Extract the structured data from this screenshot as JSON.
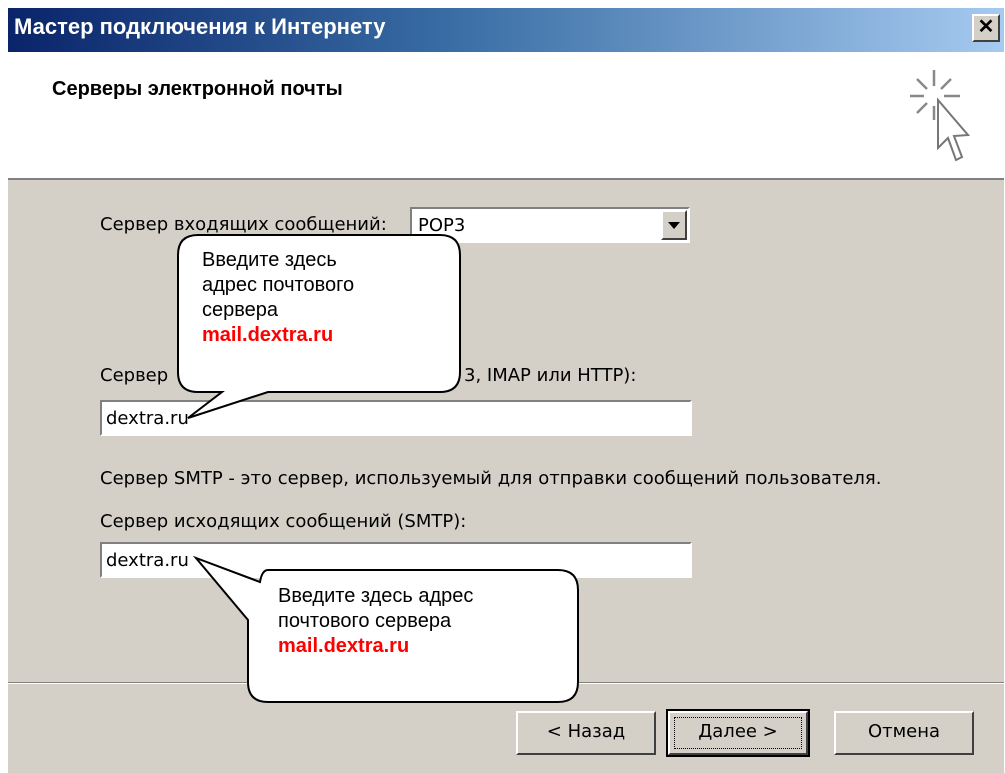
{
  "window": {
    "title": "Мастер подключения к Интернету",
    "close_label": "✕"
  },
  "header": {
    "title": "Серверы электронной почты",
    "icon": "wizard-cursor-icon"
  },
  "form": {
    "incoming_type_label": "Сервер входящих сообщений:",
    "incoming_type_value": "POP3",
    "incoming_server_label_start": "Сервер ",
    "incoming_server_label_end": "3, IMAP или HTTP):",
    "incoming_server_value": "dextra.ru",
    "smtp_note": "Сервер SMTP - это сервер, используемый для отправки сообщений  пользователя.",
    "outgoing_server_label": "Сервер исходящих сообщений (SMTP):",
    "outgoing_server_value": "dextra.ru"
  },
  "callouts": {
    "top": {
      "line1": "Введите здесь",
      "line2": "адрес почтового",
      "line3": "сервера",
      "highlight": "mail.dextra.ru"
    },
    "bottom": {
      "line1": "Введите здесь адрес",
      "line2": "почтового сервера",
      "highlight": "mail.dextra.ru"
    }
  },
  "buttons": {
    "back": "< Назад",
    "next": "Далее >",
    "cancel": "Отмена"
  },
  "colors": {
    "title_gradient_start": "#0a246a",
    "title_gradient_end": "#a6caf0",
    "dialog_face": "#d4d0c8",
    "callout_highlight": "#ff0000"
  }
}
